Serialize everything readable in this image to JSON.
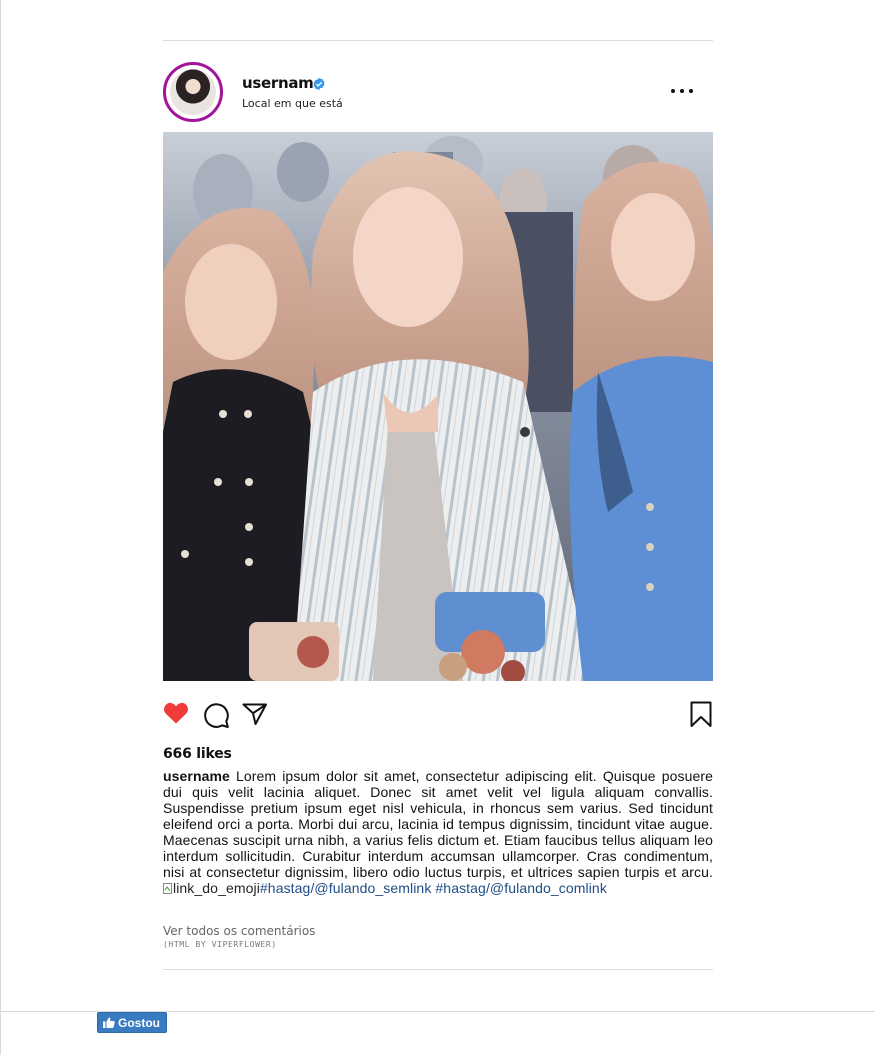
{
  "post": {
    "username": "username",
    "location": "Local em que está",
    "likes": "666 likes",
    "caption": {
      "username": "username",
      "text": " Lorem ipsum dolor sit amet, consectetur adipiscing elit. Quisque posuere dui quis velit lacinia aliquet. Donec sit amet velit vel ligula aliquam convallis. Suspendisse pretium ipsum eget nisl vehicula, in rhoncus sem varius. Sed tincidunt eleifend orci a porta. Morbi dui arcu, lacinia id tempus dignissim, tincidunt vitae augue. Maecenas suscipit urna nibh, a varius felis dictum et. Etiam faucibus tellus aliquam leo interdum sollicitudin. Curabitur interdum accumsan ullamcorper. Cras condimentum, nisi at consectetur dignissim, libero odio luctus turpis, et ultrices sapien turpis et arcu. ",
      "broken_image_alt": "link_do_emoji",
      "hashtag_1": "#hastag/@fulando_semlink",
      "hashtag_2": "#hastag/@fulando_comlink"
    },
    "view_comments": "Ver todos os comentários",
    "credit": "(HTML BY VIPERFLOWER)",
    "liked": true
  },
  "footer": {
    "like_button_label": "Gostou"
  },
  "icons": {
    "verified": "verified-badge-icon",
    "more": "more-options-icon",
    "like": "heart-icon",
    "comment": "comment-bubble-icon",
    "share": "paper-plane-icon",
    "save": "bookmark-icon",
    "thumbs": "thumbs-up-icon"
  },
  "colors": {
    "heart": "#f03b3b",
    "avatar_ring": "#a2149b",
    "verified": "#3897f0",
    "hashtag": "#1f4c86",
    "like_button": "#3a7ac1"
  }
}
